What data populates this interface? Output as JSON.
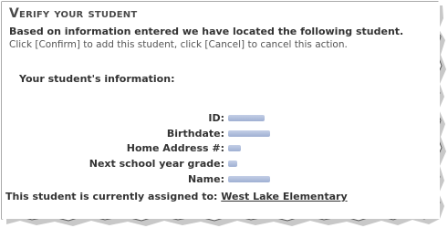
{
  "header": {
    "title": "Verify your student",
    "subtitle": "Based on information entered we have located the following student.",
    "instruction": "Click [Confirm] to add this student, click [Cancel] to cancel this action."
  },
  "student_info": {
    "heading": "Your student's information:",
    "fields": [
      {
        "label": "ID:",
        "value": "",
        "redacted": true
      },
      {
        "label": "Birthdate:",
        "value": "",
        "redacted": true
      },
      {
        "label": "Home Address #:",
        "value": "",
        "redacted": true
      },
      {
        "label": "Next school year grade:",
        "value": "",
        "redacted": true
      },
      {
        "label": "Name:",
        "value": "",
        "redacted": true
      }
    ]
  },
  "assignment": {
    "prefix": "This student is currently assigned to:",
    "school": "West Lake Elementary"
  },
  "colors": {
    "redaction_blur": "#b3c1de",
    "text": "#333333",
    "border": "#555555"
  }
}
